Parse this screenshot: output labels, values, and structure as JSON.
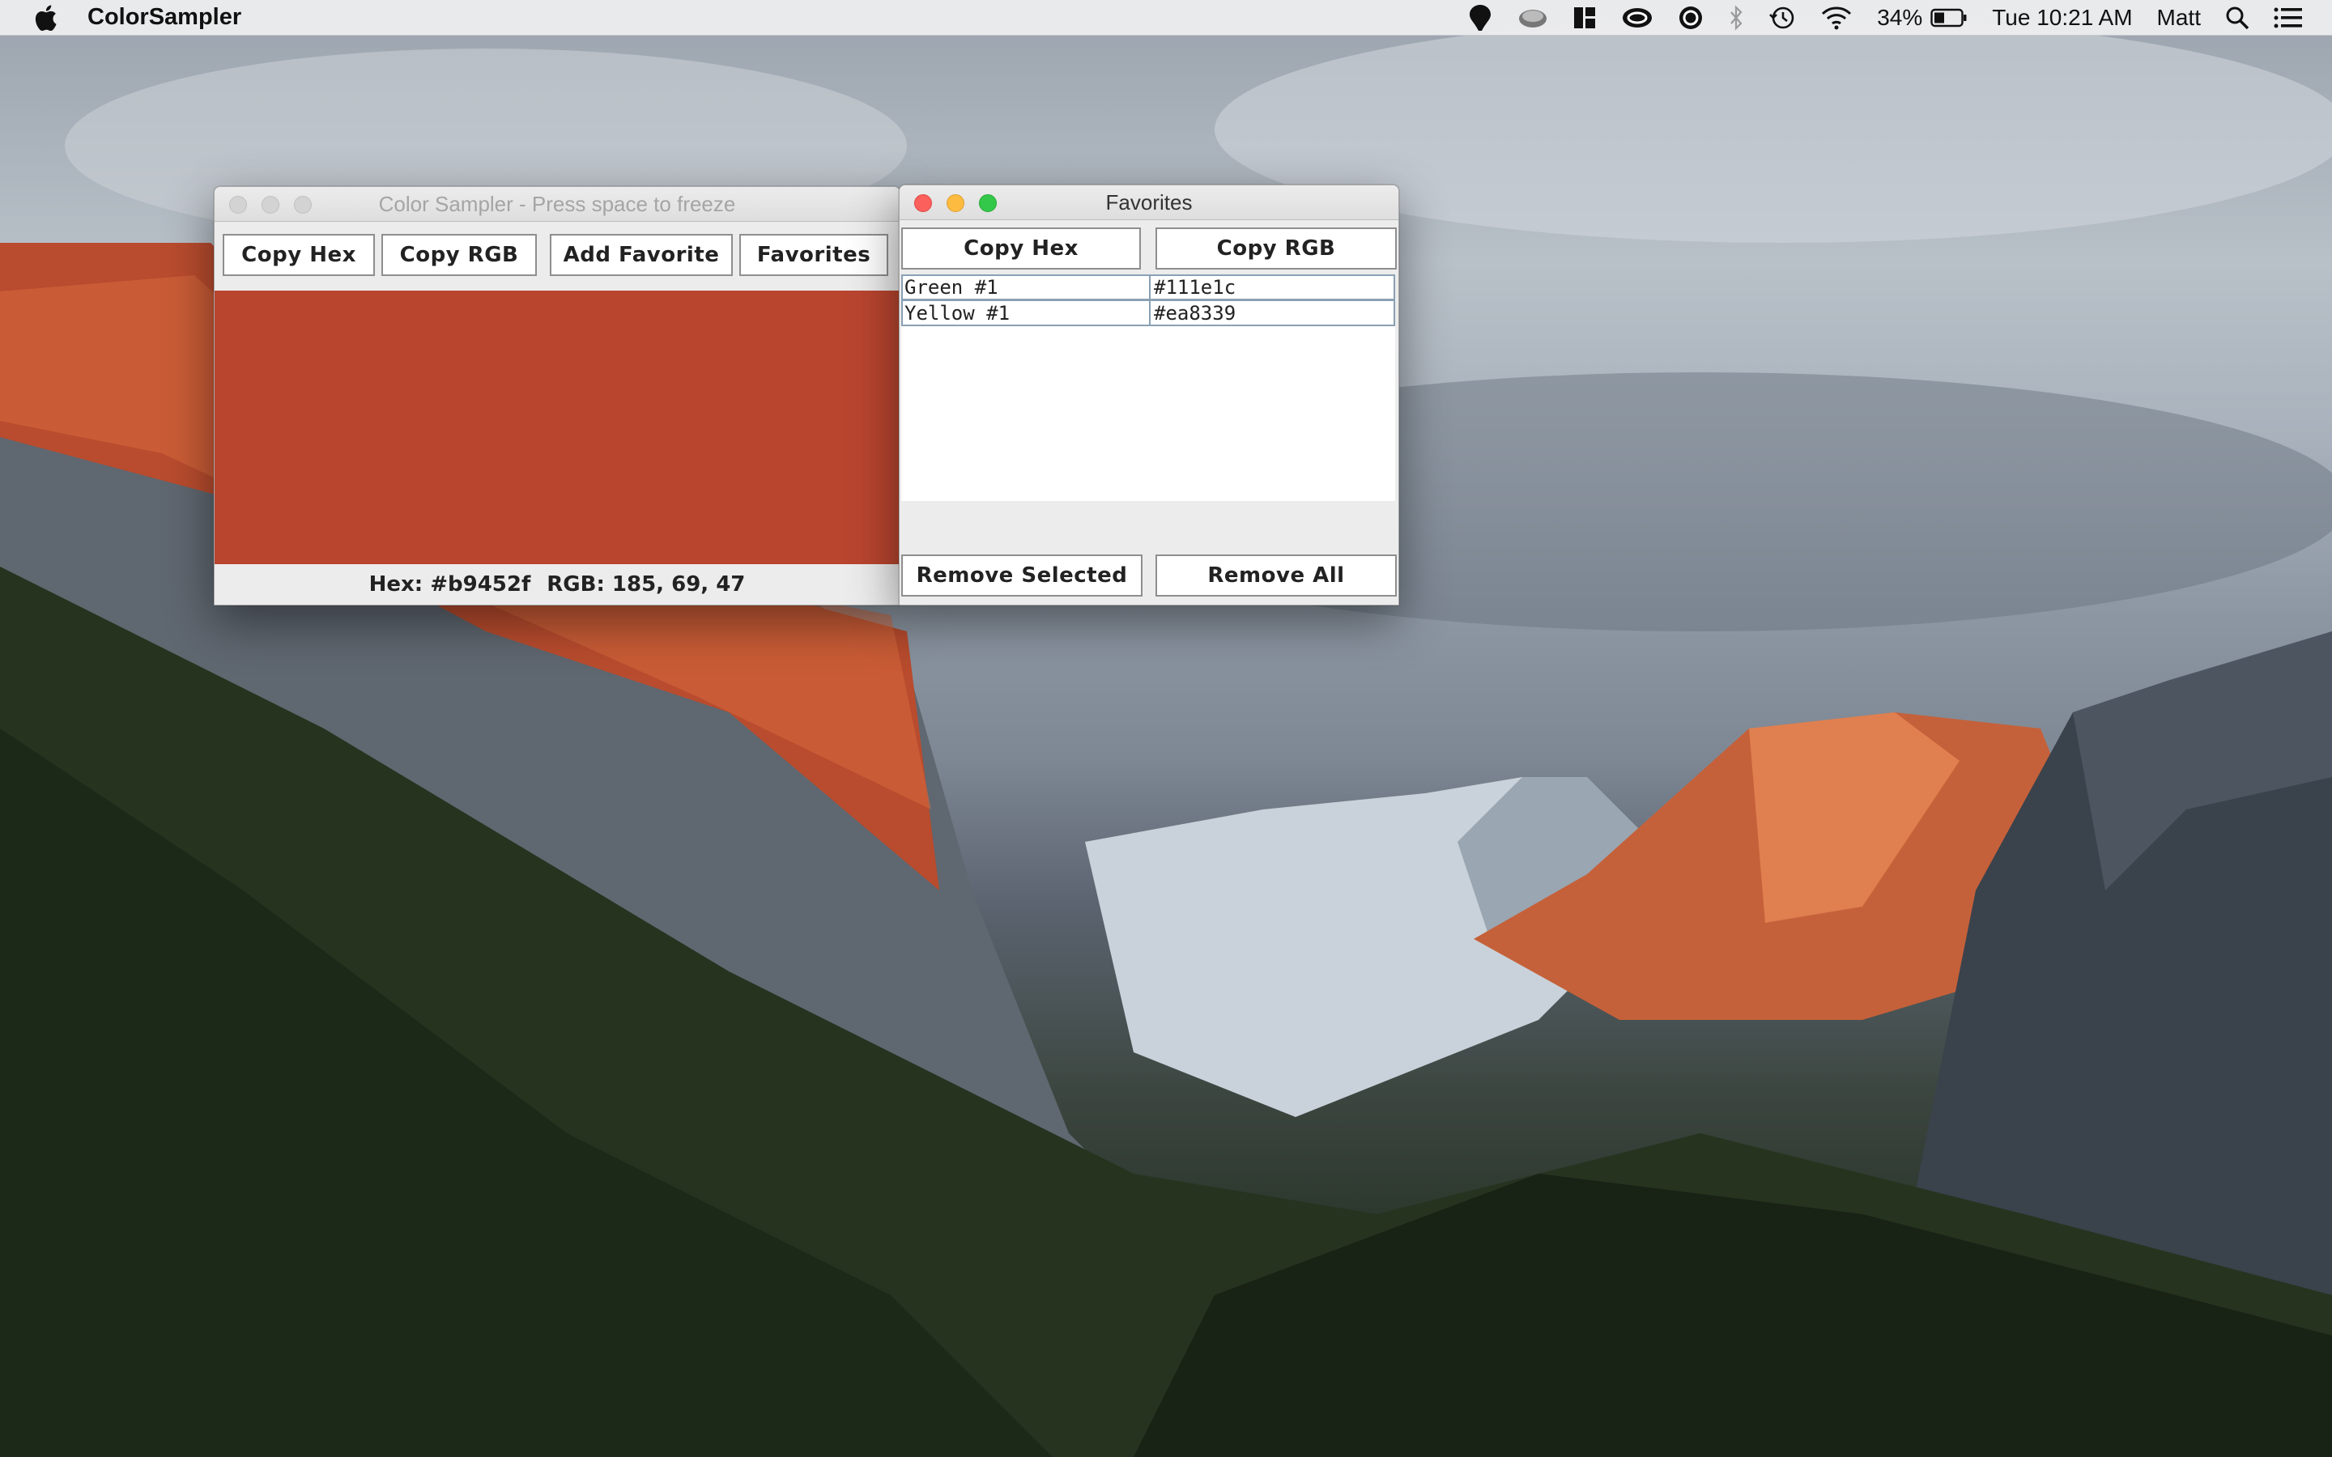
{
  "menubar": {
    "app_name": "ColorSampler",
    "battery": "34%",
    "clock": "Tue 10:21 AM",
    "user": "Matt",
    "status_icons": [
      "marker-icon",
      "cloud-drive-icon",
      "layout-icon",
      "creative-cloud-icon",
      "arq-icon",
      "bluetooth-icon",
      "time-machine-icon",
      "wifi-icon",
      "battery-icon"
    ]
  },
  "sampler": {
    "title": "Color Sampler - Press space to freeze",
    "buttons": {
      "copy_hex": "Copy Hex",
      "copy_rgb": "Copy RGB",
      "add_favorite": "Add Favorite",
      "favorites": "Favorites"
    },
    "current_color": "#b9452f",
    "hex_text": "Hex: #b9452f",
    "rgb_text": "RGB: 185, 69, 47"
  },
  "favorites": {
    "title": "Favorites",
    "buttons": {
      "copy_hex": "Copy Hex",
      "copy_rgb": "Copy RGB",
      "remove_selected": "Remove Selected",
      "remove_all": "Remove All"
    },
    "items": [
      {
        "name": "Green #1",
        "hex": "#111e1c"
      },
      {
        "name": "Yellow #1",
        "hex": "#ea8339"
      }
    ]
  }
}
